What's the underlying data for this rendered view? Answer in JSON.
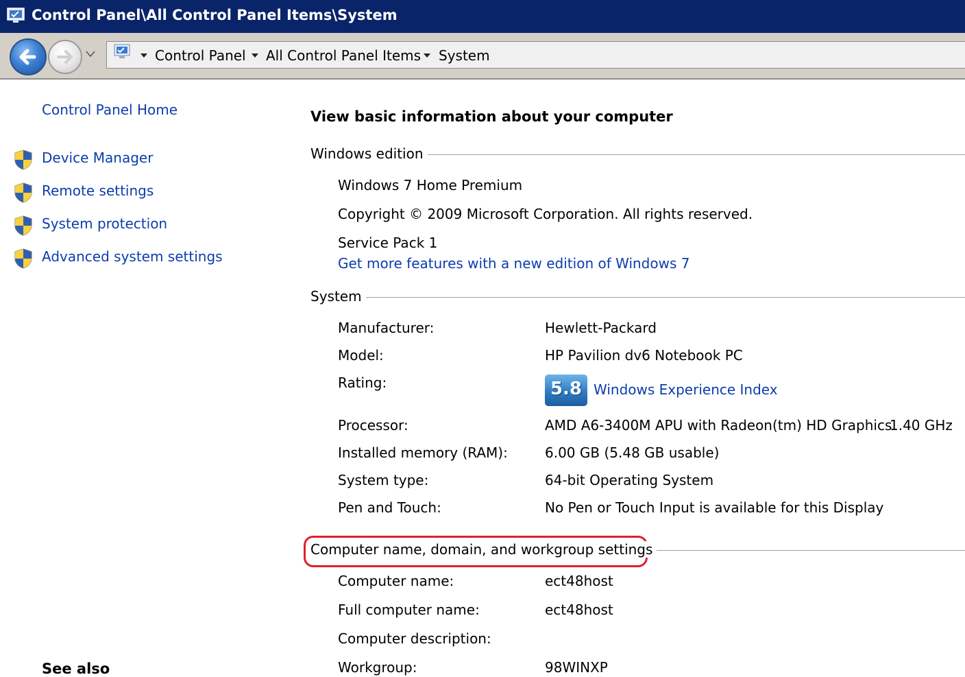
{
  "window": {
    "title": "Control Panel\\All Control Panel Items\\System",
    "icon": "control-panel-system-icon"
  },
  "address_bar": {
    "crumbs": [
      "Control Panel",
      "All Control Panel Items",
      "System"
    ],
    "location_icon": "computer-icon"
  },
  "sidebar": {
    "home_link": "Control Panel Home",
    "tasks": [
      {
        "label": "Device Manager",
        "icon": "uac-shield-icon"
      },
      {
        "label": "Remote settings",
        "icon": "uac-shield-icon"
      },
      {
        "label": "System protection",
        "icon": "uac-shield-icon"
      },
      {
        "label": "Advanced system settings",
        "icon": "uac-shield-icon"
      }
    ],
    "see_also": "See also"
  },
  "main": {
    "heading": "View basic information about your computer",
    "edition": {
      "section_title": "Windows edition",
      "name": "Windows 7 Home Premium",
      "copyright": "Copyright © 2009 Microsoft Corporation.  All rights reserved.",
      "service_pack": "Service Pack 1",
      "upgrade_link": "Get more features with a new edition of Windows 7"
    },
    "system": {
      "section_title": "System",
      "manufacturer_label": "Manufacturer:",
      "manufacturer": "Hewlett-Packard",
      "model_label": "Model:",
      "model": "HP Pavilion dv6 Notebook PC",
      "rating_label": "Rating:",
      "rating_score": "5.8",
      "rating_link": "Windows Experience Index",
      "processor_label": "Processor:",
      "processor": "AMD A6-3400M APU with Radeon(tm) HD Graphics",
      "processor_speed": "1.40 GHz",
      "memory_label": "Installed memory (RAM):",
      "memory": "6.00 GB (5.48 GB usable)",
      "type_label": "System type:",
      "type": "64-bit Operating System",
      "pen_label": "Pen and Touch:",
      "pen": "No Pen or Touch Input is available for this Display"
    },
    "computer_name": {
      "section_title": "Computer name, domain, and workgroup settings",
      "name_label": "Computer name:",
      "name": "ect48host",
      "full_name_label": "Full computer name:",
      "full_name": "ect48host",
      "description_label": "Computer description:",
      "description": "",
      "workgroup_label": "Workgroup:",
      "workgroup": "98WINXP"
    }
  },
  "colors": {
    "titlebar": "#0a246a",
    "link": "#0c3dad",
    "highlight": "#e0202a"
  }
}
